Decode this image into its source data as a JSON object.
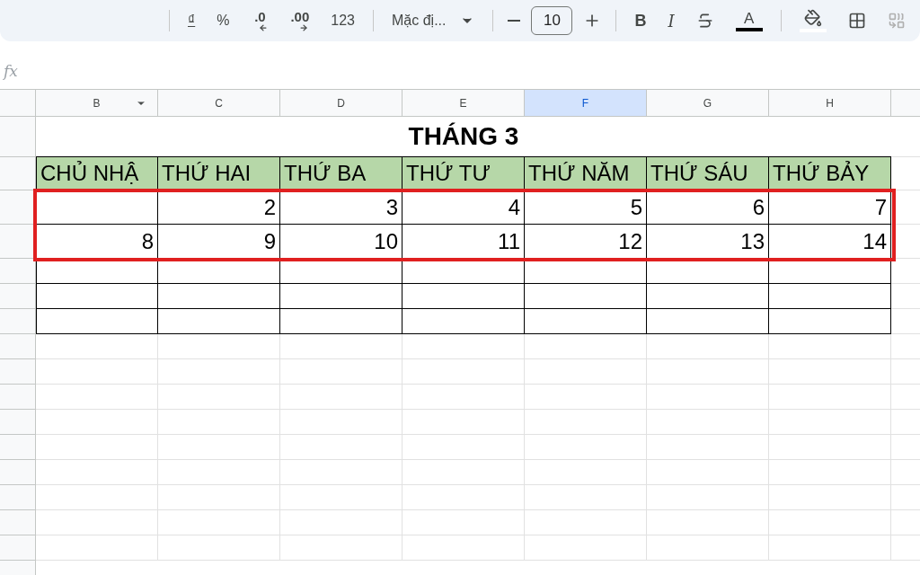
{
  "toolbar": {
    "items": [
      {
        "kind": "separator"
      },
      {
        "kind": "currency",
        "label": "₫"
      },
      {
        "kind": "text",
        "label": "%"
      },
      {
        "kind": "decimal-decrease",
        "label": ".0"
      },
      {
        "kind": "decimal-increase",
        "label": ".00"
      },
      {
        "kind": "text",
        "label": "123"
      },
      {
        "kind": "separator"
      },
      {
        "kind": "font",
        "label": "Mặc đị..."
      },
      {
        "kind": "separator"
      },
      {
        "kind": "minus"
      },
      {
        "kind": "size-field",
        "value": "10"
      },
      {
        "kind": "plus"
      },
      {
        "kind": "separator"
      },
      {
        "kind": "bold",
        "label": "B"
      },
      {
        "kind": "italic",
        "label": "I"
      },
      {
        "kind": "strike"
      },
      {
        "kind": "text-color",
        "label": "A"
      },
      {
        "kind": "separator"
      },
      {
        "kind": "fill"
      },
      {
        "kind": "borders"
      },
      {
        "kind": "merge"
      }
    ]
  },
  "formula_bar": {
    "label": "fx"
  },
  "sheet": {
    "columns": [
      {
        "label": "B",
        "selected": false,
        "filter": true
      },
      {
        "label": "C",
        "selected": false,
        "filter": false
      },
      {
        "label": "D",
        "selected": false,
        "filter": false
      },
      {
        "label": "E",
        "selected": false,
        "filter": false
      },
      {
        "label": "F",
        "selected": true,
        "filter": false
      },
      {
        "label": "G",
        "selected": false,
        "filter": false
      },
      {
        "label": "H",
        "selected": false,
        "filter": false
      }
    ],
    "title": "THÁNG 3",
    "day_headers": [
      "CHỦ NHẬ",
      "THỨ HAI",
      "THỨ BA",
      "THỨ TƯ",
      "THỨ NĂM",
      "THỨ SÁU",
      "THỨ BẢY"
    ],
    "rows": [
      [
        "",
        "2",
        "3",
        "4",
        "5",
        "6",
        "7"
      ],
      [
        "8",
        "9",
        "10",
        "11",
        "12",
        "13",
        "14"
      ]
    ],
    "highlight": true
  }
}
